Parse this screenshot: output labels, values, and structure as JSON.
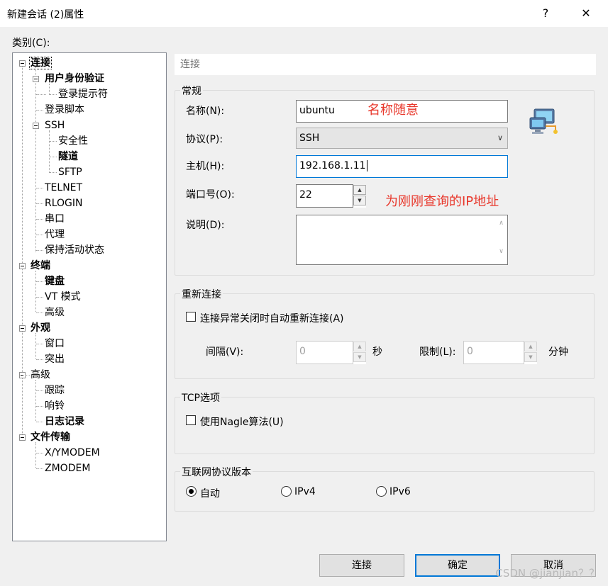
{
  "window": {
    "title": "新建会话 (2)属性",
    "help": "?",
    "close": "✕"
  },
  "category_label": "类别(C):",
  "tree": [
    {
      "label": "连接",
      "bold": true
    },
    {
      "label": "用户身份验证",
      "bold": true
    },
    {
      "label": "登录提示符",
      "bold": false
    },
    {
      "label": "登录脚本",
      "bold": false
    },
    {
      "label": "SSH",
      "bold": false
    },
    {
      "label": "安全性",
      "bold": false
    },
    {
      "label": "隧道",
      "bold": true
    },
    {
      "label": "SFTP",
      "bold": false
    },
    {
      "label": "TELNET",
      "bold": false
    },
    {
      "label": "RLOGIN",
      "bold": false
    },
    {
      "label": "串口",
      "bold": false
    },
    {
      "label": "代理",
      "bold": false
    },
    {
      "label": "保持活动状态",
      "bold": false
    },
    {
      "label": "终端",
      "bold": true
    },
    {
      "label": "键盘",
      "bold": true
    },
    {
      "label": "VT 模式",
      "bold": false
    },
    {
      "label": "高级",
      "bold": false
    },
    {
      "label": "外观",
      "bold": true
    },
    {
      "label": "窗口",
      "bold": false
    },
    {
      "label": "突出",
      "bold": false
    },
    {
      "label": "高级",
      "bold": false
    },
    {
      "label": "跟踪",
      "bold": false
    },
    {
      "label": "响铃",
      "bold": false
    },
    {
      "label": "日志记录",
      "bold": true
    },
    {
      "label": "文件传输",
      "bold": true
    },
    {
      "label": "X/YMODEM",
      "bold": false
    },
    {
      "label": "ZMODEM",
      "bold": false
    }
  ],
  "section_header": "连接",
  "general": {
    "title": "常规",
    "name_label": "名称(N):",
    "name_value": "ubuntu",
    "protocol_label": "协议(P):",
    "protocol_value": "SSH",
    "host_label": "主机(H):",
    "host_value": "192.168.1.11",
    "port_label": "端口号(O):",
    "port_value": "22",
    "desc_label": "说明(D):",
    "desc_value": ""
  },
  "notes": {
    "name_note": "名称随意",
    "port_note": "为刚刚查询的IP地址"
  },
  "reconnect": {
    "title": "重新连接",
    "checkbox_label": "连接异常关闭时自动重新连接(A)",
    "interval_label": "间隔(V):",
    "interval_value": "0",
    "interval_unit": "秒",
    "limit_label": "限制(L):",
    "limit_value": "0",
    "limit_unit": "分钟"
  },
  "tcp": {
    "title": "TCP选项",
    "nagle_label": "使用Nagle算法(U)"
  },
  "ipver": {
    "title": "互联网协议版本",
    "auto": "自动",
    "ipv4": "IPv4",
    "ipv6": "IPv6"
  },
  "buttons": {
    "connect": "连接",
    "ok": "确定",
    "cancel": "取消"
  },
  "watermark": "CSDN @jianjian？？"
}
